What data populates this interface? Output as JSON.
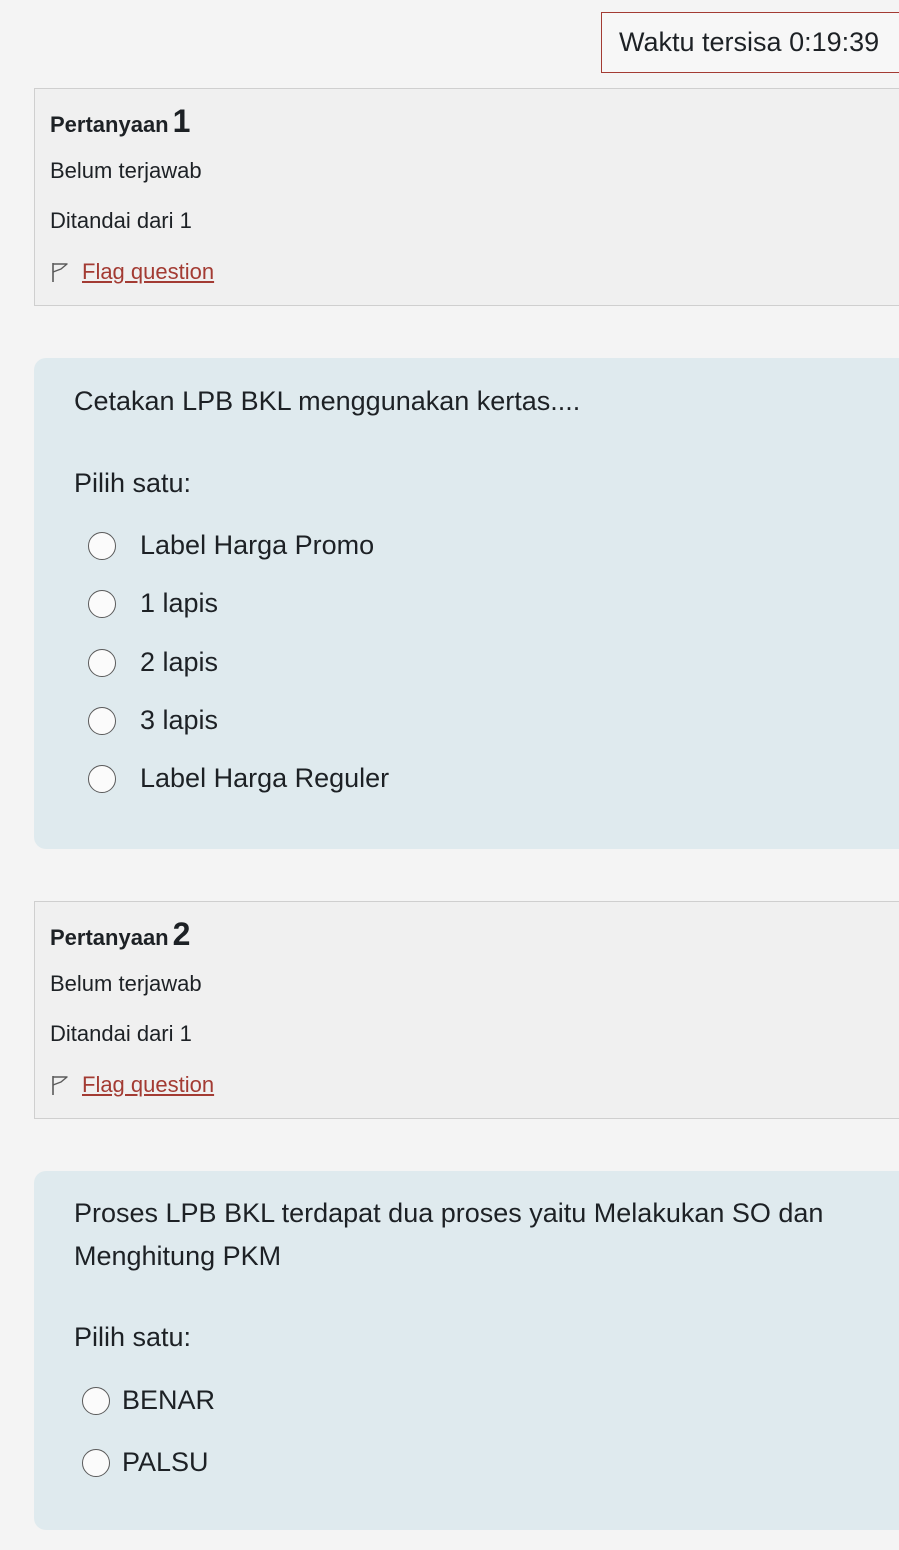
{
  "timer": {
    "label": "Waktu tersisa",
    "value": "0:19:39"
  },
  "questions": [
    {
      "label": "Pertanyaan",
      "number": "1",
      "state": "Belum terjawab",
      "grade": "Ditandai dari 1",
      "flag_label": "Flag question",
      "text": "Cetakan LPB BKL menggunakan kertas....",
      "prompt": "Pilih satu:",
      "options": [
        "Label Harga Promo",
        "1 lapis",
        "2 lapis",
        "3 lapis",
        "Label Harga Reguler"
      ]
    },
    {
      "label": "Pertanyaan",
      "number": "2",
      "state": "Belum terjawab",
      "grade": "Ditandai dari 1",
      "flag_label": "Flag question",
      "text": "Proses LPB BKL terdapat dua proses yaitu Melakukan SO dan Menghitung PKM",
      "prompt": "Pilih satu:",
      "options": [
        "BENAR",
        "PALSU"
      ]
    }
  ],
  "colors": {
    "accent": "#a33b33",
    "content_background": "#dfeaee",
    "info_background": "#f0f0f0"
  }
}
